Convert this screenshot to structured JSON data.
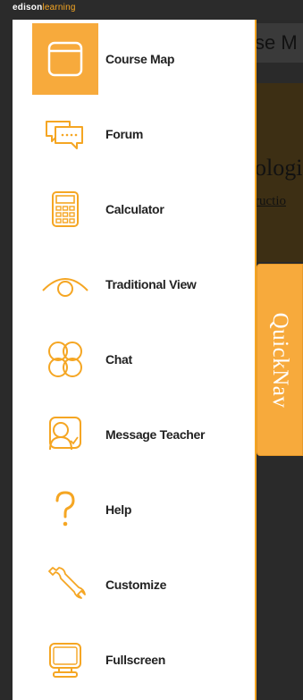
{
  "brand": {
    "name_part1": "edison",
    "name_part2": "learning"
  },
  "background": {
    "header_text": "se M",
    "card_title": "ologi",
    "card_link": "ructio"
  },
  "quicknav": {
    "label": "QuickNav"
  },
  "menu": {
    "items": [
      {
        "label": "Course Map",
        "icon": "course-map-icon",
        "active": true
      },
      {
        "label": "Forum",
        "icon": "forum-icon",
        "active": false
      },
      {
        "label": "Calculator",
        "icon": "calculator-icon",
        "active": false
      },
      {
        "label": "Traditional View",
        "icon": "eye-icon",
        "active": false
      },
      {
        "label": "Chat",
        "icon": "chat-icon",
        "active": false
      },
      {
        "label": "Message Teacher",
        "icon": "message-teacher-icon",
        "active": false
      },
      {
        "label": "Help",
        "icon": "help-icon",
        "active": false
      },
      {
        "label": "Customize",
        "icon": "wrench-icon",
        "active": false
      },
      {
        "label": "Fullscreen",
        "icon": "monitor-icon",
        "active": false
      }
    ]
  },
  "colors": {
    "accent": "#f7aa3c",
    "icon_stroke": "#f5a623",
    "panel_bg": "#ffffff",
    "page_bg": "#2a2a2a"
  }
}
